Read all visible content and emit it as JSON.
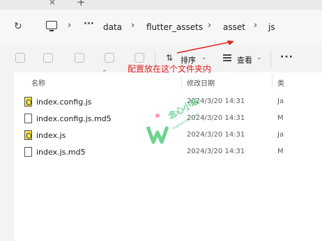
{
  "tabs": {
    "close_glyph": "×",
    "new_tab_glyph": "+"
  },
  "address_bar": {
    "more_glyph": "···",
    "breadcrumbs": [
      "data",
      "flutter_assets",
      "asset",
      "js"
    ],
    "separator": "›"
  },
  "toolbar": {
    "sort_label": "排序",
    "view_label": "查看",
    "more_glyph": "···"
  },
  "columns": {
    "name": "名称",
    "date": "修改日期",
    "type": "类"
  },
  "files": [
    {
      "name": "index.config.js",
      "date": "2024/3/20 14:31",
      "type": "Ja",
      "icon": "js-file-icon"
    },
    {
      "name": "index.config.js.md5",
      "date": "2024/3/20 14:31",
      "type": "M",
      "icon": "file-icon"
    },
    {
      "name": "index.js",
      "date": "2024/3/20 14:31",
      "type": "Ja",
      "icon": "js-file-icon"
    },
    {
      "name": "index.js.md5",
      "date": "2024/3/20 14:31",
      "type": "M",
      "icon": "file-icon"
    }
  ],
  "annotation": {
    "text": "配置放在这个文件夹内",
    "color": "#e02020"
  },
  "watermark": {
    "text": "念心小站",
    "sub": "nianxinxz.com",
    "color": "#3cc36b"
  }
}
